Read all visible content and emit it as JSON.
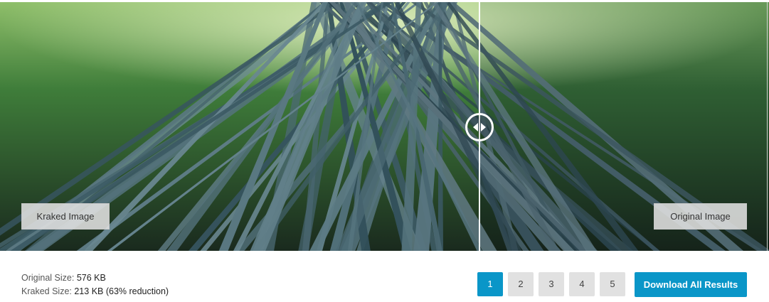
{
  "compare": {
    "left_label": "Kraked Image",
    "right_label": "Original Image"
  },
  "stats": {
    "original_label": "Original Size:",
    "original_value": "576 KB",
    "kraked_label": "Kraked Size:",
    "kraked_value": "213 KB (63% reduction)"
  },
  "pagination": {
    "pages": [
      "1",
      "2",
      "3",
      "4",
      "5"
    ],
    "active": "1"
  },
  "download_label": "Download All Results",
  "colors": {
    "accent": "#0a96c8",
    "page_inactive": "#e1e1e1"
  },
  "icons": {
    "slider_handle": "left-right-arrows-icon"
  }
}
